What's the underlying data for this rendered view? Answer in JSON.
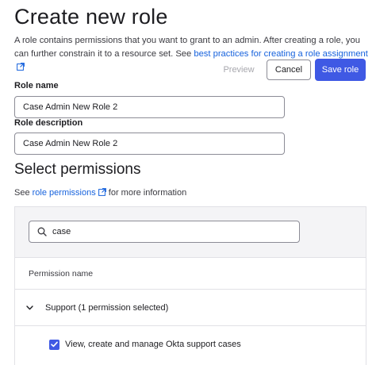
{
  "header": {
    "title": "Create new role",
    "intro_text": "A role contains permissions that you want to grant to an admin. After creating a role, you can further constrain it to a resource set. See ",
    "intro_link": "best practices for creating a role assignment"
  },
  "actions": {
    "preview_label": "Preview",
    "cancel_label": "Cancel",
    "save_label": "Save role"
  },
  "form": {
    "role_name_label": "Role name",
    "role_name_value": "Case Admin New Role 2",
    "role_description_label": "Role description",
    "role_description_value": "Case Admin New Role 2"
  },
  "permissions": {
    "section_title": "Select permissions",
    "see_prefix": "See ",
    "see_link": "role permissions",
    "see_suffix": " for more information",
    "search_value": "case",
    "column_header": "Permission name",
    "groups": [
      {
        "label": "Support (1 permission selected)",
        "expanded": true,
        "items": [
          {
            "label": "View, create and manage Okta support cases",
            "checked": true
          }
        ]
      }
    ]
  },
  "colors": {
    "accent": "#3f59e4",
    "link": "#1662dd",
    "panel_band": "#f4f4f6",
    "border": "#e1e1e6"
  },
  "icons": {
    "external_link": "external-link-icon",
    "search": "search-icon",
    "chevron": "chevron-down-icon",
    "checkmark": "checkmark-icon"
  }
}
